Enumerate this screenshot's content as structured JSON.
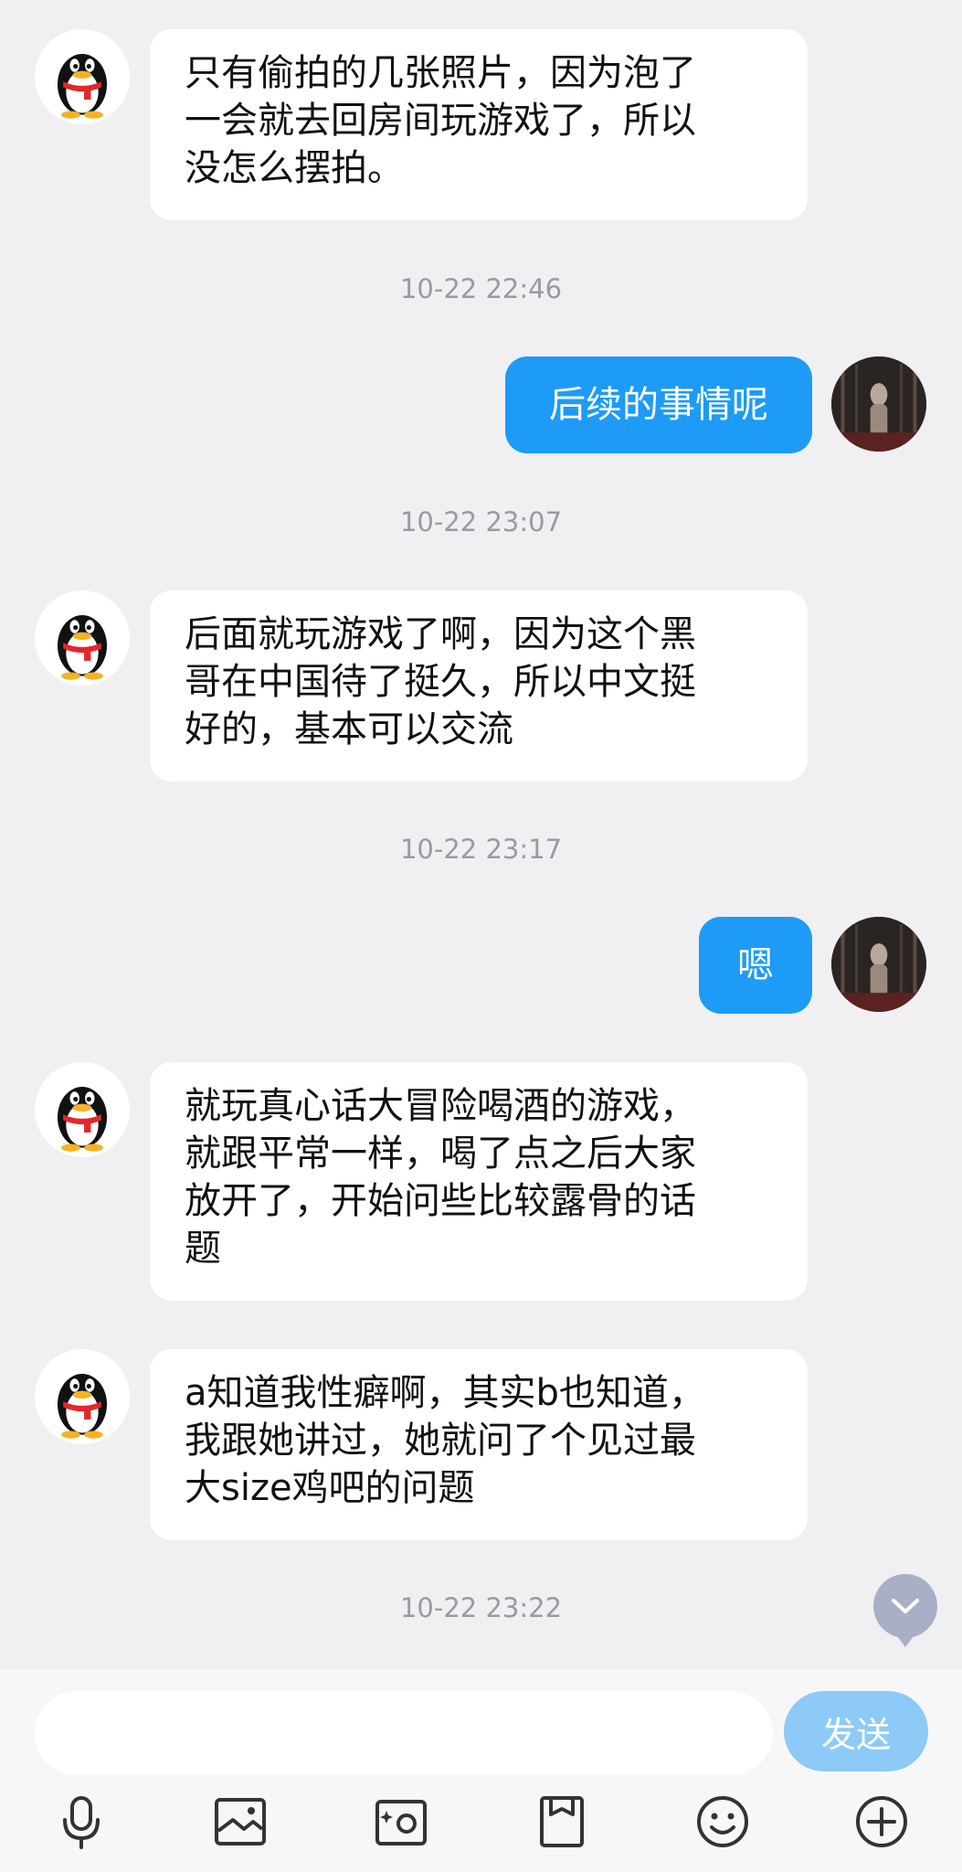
{
  "messages": [
    {
      "side": "in",
      "text": "只有偷拍的几张照片，因为泡了\n一会就去回房间玩游戏了，所以\n没怎么摆拍。"
    },
    {
      "time": "10-22 22:46"
    },
    {
      "side": "out",
      "text": "后续的事情呢"
    },
    {
      "time": "10-22 23:07"
    },
    {
      "side": "in",
      "text": "后面就玩游戏了啊，因为这个黑\n哥在中国待了挺久，所以中文挺\n好的，基本可以交流"
    },
    {
      "time": "10-22 23:17"
    },
    {
      "side": "out",
      "text": "嗯"
    },
    {
      "side": "in",
      "text": "就玩真心话大冒险喝酒的游戏，\n就跟平常一样，喝了点之后大家\n放开了，开始问些比较露骨的话\n题"
    },
    {
      "side": "in",
      "text": "a知道我性癖啊，其实b也知道，\n我跟她讲过，她就问了个见过最\n大size鸡吧的问题"
    },
    {
      "time": "10-22 23:22"
    }
  ],
  "input": {
    "placeholder": "",
    "value": ""
  },
  "send_label": "发送",
  "toolbar": [
    "microphone-icon",
    "image-icon",
    "camera-icon",
    "file-icon",
    "emoji-icon",
    "plus-icon"
  ],
  "colors": {
    "outgoing_bubble": "#1d9bf6",
    "incoming_bubble": "#ffffff",
    "background": "#f0f0f2",
    "send_button": "#8dcaf7"
  }
}
